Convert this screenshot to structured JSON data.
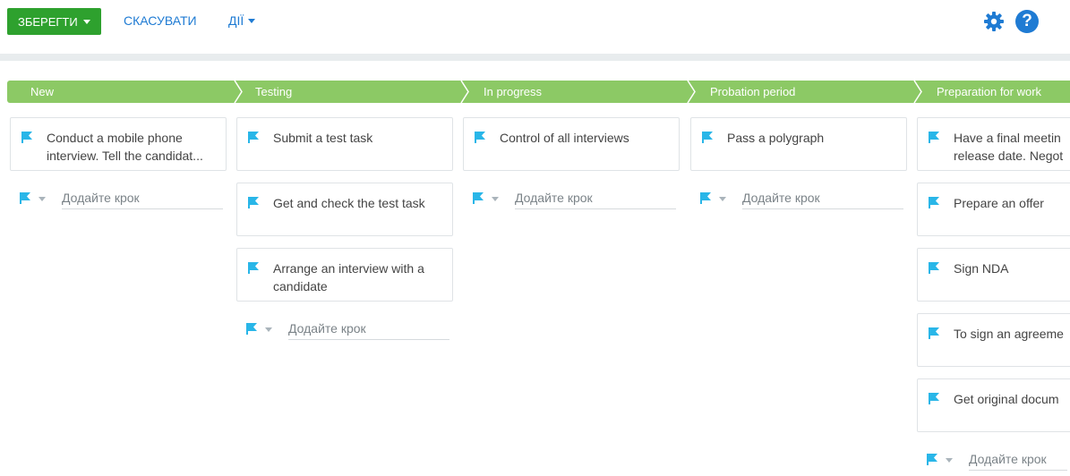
{
  "toolbar": {
    "save_label": "ЗБЕРЕГТИ",
    "cancel_label": "СКАСУВАТИ",
    "actions_label": "ДІЇ",
    "help_label": "?"
  },
  "colors": {
    "save_button": "#2ea12e",
    "link": "#1f7bd3",
    "stage_bar": "#8cc965",
    "flag": "#29b6e8"
  },
  "icons": {
    "settings": "gear-icon",
    "help": "question-icon",
    "step": "flag-icon"
  },
  "stages": [
    {
      "label": "New",
      "steps": [
        "Conduct a mobile phone interview. Tell the candidat..."
      ],
      "add_placeholder": "Додайте крок"
    },
    {
      "label": "Testing",
      "steps": [
        "Submit a test task",
        "Get and check the test task",
        "Arrange an interview with a candidate"
      ],
      "add_placeholder": "Додайте крок"
    },
    {
      "label": "In progress",
      "steps": [
        "Control of all interviews"
      ],
      "add_placeholder": "Додайте крок"
    },
    {
      "label": "Probation period",
      "steps": [
        "Pass a polygraph"
      ],
      "add_placeholder": "Додайте крок"
    },
    {
      "label": "Preparation for work",
      "steps": [
        "Have a final meetin release date. Negot",
        "Prepare an offer",
        "Sign NDA",
        "To sign an agreeme",
        "Get original docum"
      ],
      "add_placeholder": "Додайте крок"
    }
  ]
}
